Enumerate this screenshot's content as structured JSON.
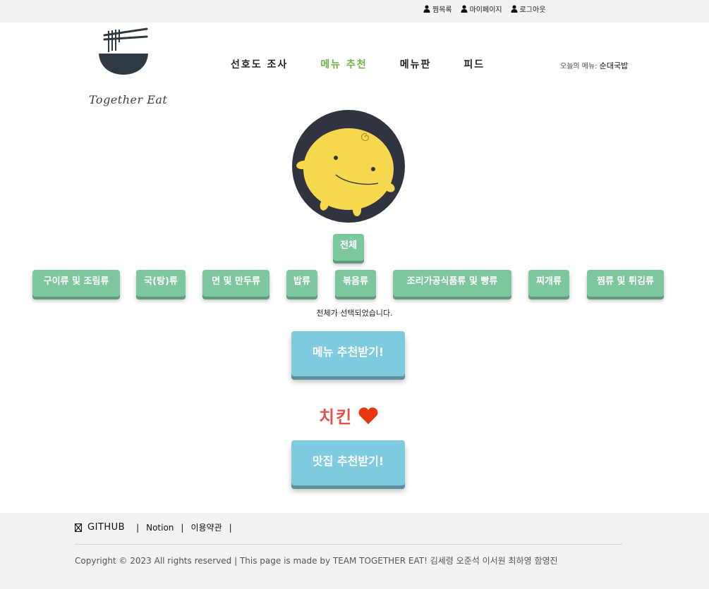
{
  "topbar": {
    "links": [
      {
        "icon": "person-icon",
        "label": "찜목록"
      },
      {
        "icon": "person-icon",
        "label": "마이페이지"
      },
      {
        "icon": "person-icon",
        "label": "로그아웃"
      }
    ]
  },
  "header": {
    "logo_text": "Together Eat",
    "nav": [
      {
        "label": "선호도 조사",
        "active": false
      },
      {
        "label": "메뉴 추천",
        "active": true
      },
      {
        "label": "메뉴판",
        "active": false
      },
      {
        "label": "피드",
        "active": false
      }
    ],
    "today_label": "오늘의 메뉴:",
    "today_menu": "순대국밥"
  },
  "categories": {
    "all": "전체",
    "items": [
      "구이류 및 조림류",
      "국(탕)류",
      "면 및 만두류",
      "밥류",
      "볶음류",
      "조리가공식품류 및 빵류",
      "찌개류",
      "찜류 및 튀김류"
    ],
    "selected_msg": "전체가 선택되었습니다."
  },
  "actions": {
    "recommend_menu": "메뉴 추천받기!",
    "recommend_restaurant": "맛집 추천받기!"
  },
  "result": {
    "menu": "치킨",
    "icon": "heart-icon"
  },
  "footer": {
    "github": "GITHUB",
    "notion": "Notion",
    "terms": "이용약관",
    "sep": "|",
    "copyright": "Copyright © 2023 All rights reserved | This page is made by TEAM TOGETHER EAT! 김세령 오준석 이서원 최하영 함영진"
  },
  "colors": {
    "accent_green": "#6cb33f",
    "category_button": "#7dc79e",
    "action_button": "#7ecadf",
    "result_text": "#e35151",
    "heart": "#e8360f"
  }
}
